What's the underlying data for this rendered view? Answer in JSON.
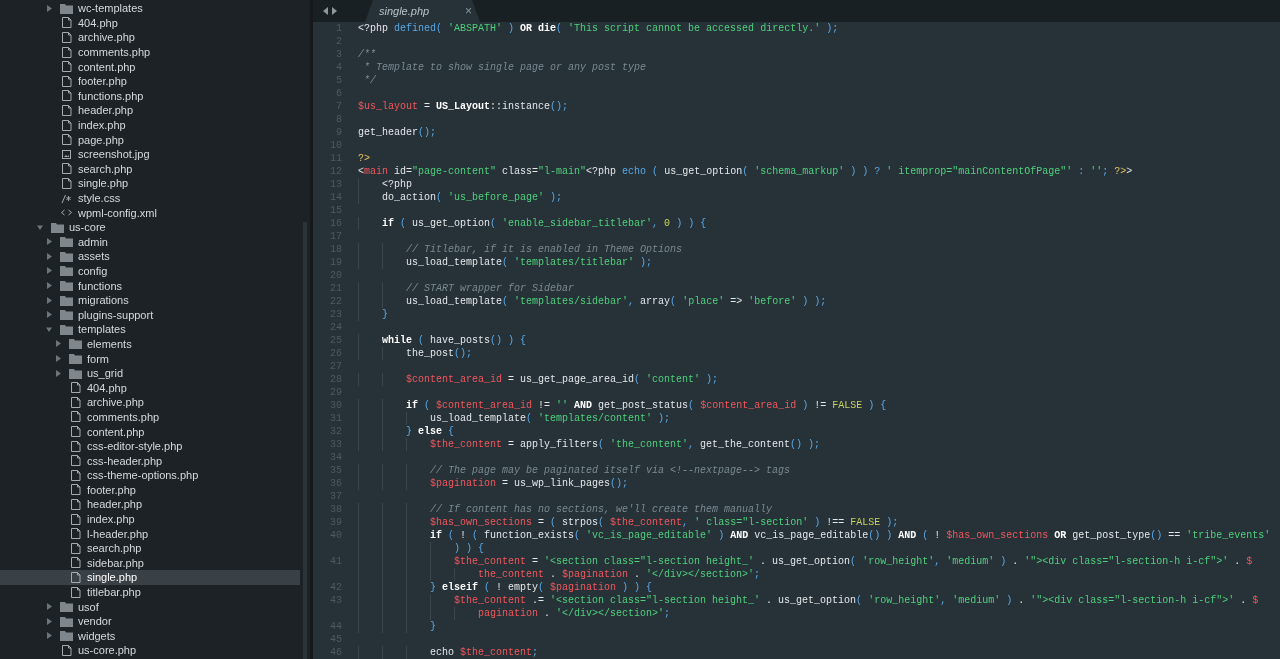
{
  "sidebar": {
    "scrolled_branch": [
      {
        "name": "wc-templates",
        "kind": "folder",
        "expanded": false,
        "selected": false
      },
      {
        "name": "404.php",
        "kind": "file",
        "selected": false
      },
      {
        "name": "archive.php",
        "kind": "file",
        "selected": false
      },
      {
        "name": "comments.php",
        "kind": "file",
        "selected": false
      },
      {
        "name": "content.php",
        "kind": "file",
        "selected": false
      },
      {
        "name": "footer.php",
        "kind": "file",
        "selected": false
      },
      {
        "name": "functions.php",
        "kind": "file",
        "selected": false
      },
      {
        "name": "header.php",
        "kind": "file",
        "selected": false
      },
      {
        "name": "index.php",
        "kind": "file",
        "selected": false
      },
      {
        "name": "page.php",
        "kind": "file",
        "selected": false
      },
      {
        "name": "screenshot.jpg",
        "kind": "image",
        "selected": false
      },
      {
        "name": "search.php",
        "kind": "file",
        "selected": false
      },
      {
        "name": "single.php",
        "kind": "file",
        "selected": false
      },
      {
        "name": "style.css",
        "kind": "css",
        "selected": false
      },
      {
        "name": "wpml-config.xml",
        "kind": "markup",
        "selected": false
      }
    ],
    "items": [
      {
        "name": "us-core",
        "kind": "folder",
        "expanded": true,
        "selected": false,
        "children": [
          {
            "name": "admin",
            "kind": "folder",
            "expanded": false,
            "selected": false
          },
          {
            "name": "assets",
            "kind": "folder",
            "expanded": false,
            "selected": false
          },
          {
            "name": "config",
            "kind": "folder",
            "expanded": false,
            "selected": false
          },
          {
            "name": "functions",
            "kind": "folder",
            "expanded": false,
            "selected": false
          },
          {
            "name": "migrations",
            "kind": "folder",
            "expanded": false,
            "selected": false
          },
          {
            "name": "plugins-support",
            "kind": "folder",
            "expanded": false,
            "selected": false
          },
          {
            "name": "templates",
            "kind": "folder",
            "expanded": true,
            "selected": false,
            "children": [
              {
                "name": "elements",
                "kind": "folder",
                "expanded": false,
                "selected": false
              },
              {
                "name": "form",
                "kind": "folder",
                "expanded": false,
                "selected": false
              },
              {
                "name": "us_grid",
                "kind": "folder",
                "expanded": false,
                "selected": false
              },
              {
                "name": "404.php",
                "kind": "file",
                "selected": false
              },
              {
                "name": "archive.php",
                "kind": "file",
                "selected": false
              },
              {
                "name": "comments.php",
                "kind": "file",
                "selected": false
              },
              {
                "name": "content.php",
                "kind": "file",
                "selected": false
              },
              {
                "name": "css-editor-style.php",
                "kind": "file",
                "selected": false
              },
              {
                "name": "css-header.php",
                "kind": "file",
                "selected": false
              },
              {
                "name": "css-theme-options.php",
                "kind": "file",
                "selected": false
              },
              {
                "name": "footer.php",
                "kind": "file",
                "selected": false
              },
              {
                "name": "header.php",
                "kind": "file",
                "selected": false
              },
              {
                "name": "index.php",
                "kind": "file",
                "selected": false
              },
              {
                "name": "l-header.php",
                "kind": "file",
                "selected": false
              },
              {
                "name": "search.php",
                "kind": "file",
                "selected": false
              },
              {
                "name": "sidebar.php",
                "kind": "file",
                "selected": false
              },
              {
                "name": "single.php",
                "kind": "file",
                "selected": true
              },
              {
                "name": "titlebar.php",
                "kind": "file",
                "selected": false
              }
            ]
          },
          {
            "name": "usof",
            "kind": "folder",
            "expanded": false,
            "selected": false
          },
          {
            "name": "vendor",
            "kind": "folder",
            "expanded": false,
            "selected": false
          },
          {
            "name": "widgets",
            "kind": "folder",
            "expanded": false,
            "selected": false
          },
          {
            "name": "us-core.php",
            "kind": "file",
            "selected": false
          }
        ]
      }
    ]
  },
  "tabs": [
    {
      "label": "single.php",
      "close": "×",
      "selected": true
    }
  ],
  "editor": {
    "lines": [
      {
        "number": "1",
        "tokens": [
          {
            "kind": "p",
            "text": "<?php "
          },
          {
            "kind": "b",
            "text": "defined( "
          },
          {
            "kind": "s",
            "text": "'ABSPATH'"
          },
          {
            "kind": "b",
            "text": " ) "
          },
          {
            "kind": "k",
            "text": "OR die"
          },
          {
            "kind": "b",
            "text": "( "
          },
          {
            "kind": "s",
            "text": "'This script cannot be accessed directly.'"
          },
          {
            "kind": "b",
            "text": " );"
          }
        ]
      },
      {
        "number": "2"
      },
      {
        "number": "3",
        "tokens": [
          {
            "kind": "c",
            "text": "/**"
          }
        ]
      },
      {
        "number": "4",
        "tokens": [
          {
            "kind": "c",
            "text": " * Template to show single page or any post type"
          }
        ]
      },
      {
        "number": "5",
        "tokens": [
          {
            "kind": "c",
            "text": " */"
          }
        ]
      },
      {
        "number": "6"
      },
      {
        "number": "7",
        "tokens": [
          {
            "kind": "v",
            "text": "$us_layout"
          },
          {
            "kind": "p",
            "text": " = "
          },
          {
            "kind": "k",
            "text": "US_Layout"
          },
          {
            "kind": "p",
            "text": "::instance"
          },
          {
            "kind": "b",
            "text": "();"
          }
        ]
      },
      {
        "number": "8"
      },
      {
        "number": "9",
        "tokens": [
          {
            "kind": "p",
            "text": "get_header"
          },
          {
            "kind": "b",
            "text": "();"
          }
        ]
      },
      {
        "number": "10"
      },
      {
        "number": "11",
        "tokens": [
          {
            "kind": "y",
            "text": "?>"
          }
        ]
      },
      {
        "number": "12",
        "tokens": [
          {
            "kind": "p",
            "text": "<"
          },
          {
            "kind": "v",
            "text": "main"
          },
          {
            "kind": "p",
            "text": " id="
          },
          {
            "kind": "s",
            "text": "\"page-content\""
          },
          {
            "kind": "p",
            "text": " class="
          },
          {
            "kind": "s",
            "text": "\"l-main\""
          },
          {
            "kind": "p",
            "text": "<?php "
          },
          {
            "kind": "b",
            "text": "echo ( "
          },
          {
            "kind": "p",
            "text": "us_get_option"
          },
          {
            "kind": "b",
            "text": "( "
          },
          {
            "kind": "s",
            "text": "'schema_markup'"
          },
          {
            "kind": "b",
            "text": " ) ) ? "
          },
          {
            "kind": "s",
            "text": "' itemprop=\"mainContentOfPage\"'"
          },
          {
            "kind": "b",
            "text": " : "
          },
          {
            "kind": "s",
            "text": "''"
          },
          {
            "kind": "b",
            "text": "; "
          },
          {
            "kind": "y",
            "text": "?>"
          },
          {
            "kind": "p",
            "text": ">"
          }
        ]
      },
      {
        "number": "13",
        "tokens": [
          {
            "kind": "p",
            "text": "    <?php"
          }
        ]
      },
      {
        "number": "14",
        "tokens": [
          {
            "kind": "p",
            "text": "    do_action"
          },
          {
            "kind": "b",
            "text": "( "
          },
          {
            "kind": "s",
            "text": "'us_before_page'"
          },
          {
            "kind": "b",
            "text": " );"
          }
        ]
      },
      {
        "number": "15"
      },
      {
        "number": "16",
        "tokens": [
          {
            "kind": "k",
            "text": "    if"
          },
          {
            "kind": "b",
            "text": " ( "
          },
          {
            "kind": "p",
            "text": "us_get_option"
          },
          {
            "kind": "b",
            "text": "( "
          },
          {
            "kind": "s",
            "text": "'enable_sidebar_titlebar'"
          },
          {
            "kind": "b",
            "text": ", "
          },
          {
            "kind": "n",
            "text": "0"
          },
          {
            "kind": "b",
            "text": " ) ) {"
          }
        ]
      },
      {
        "number": "17"
      },
      {
        "number": "18",
        "tokens": [
          {
            "kind": "c",
            "text": "        // Titlebar, if it is enabled in Theme Options"
          }
        ]
      },
      {
        "number": "19",
        "tokens": [
          {
            "kind": "p",
            "text": "        us_load_template"
          },
          {
            "kind": "b",
            "text": "( "
          },
          {
            "kind": "s",
            "text": "'templates/titlebar'"
          },
          {
            "kind": "b",
            "text": " );"
          }
        ]
      },
      {
        "number": "20"
      },
      {
        "number": "21",
        "tokens": [
          {
            "kind": "c",
            "text": "        // START wrapper for Sidebar"
          }
        ]
      },
      {
        "number": "22",
        "tokens": [
          {
            "kind": "p",
            "text": "        us_load_template"
          },
          {
            "kind": "b",
            "text": "( "
          },
          {
            "kind": "s",
            "text": "'templates/sidebar'"
          },
          {
            "kind": "b",
            "text": ", "
          },
          {
            "kind": "p",
            "text": "array"
          },
          {
            "kind": "b",
            "text": "( "
          },
          {
            "kind": "s",
            "text": "'place'"
          },
          {
            "kind": "p",
            "text": " => "
          },
          {
            "kind": "s",
            "text": "'before'"
          },
          {
            "kind": "b",
            "text": " ) );"
          }
        ]
      },
      {
        "number": "23",
        "tokens": [
          {
            "kind": "b",
            "text": "    }"
          }
        ]
      },
      {
        "number": "24"
      },
      {
        "number": "25",
        "tokens": [
          {
            "kind": "k",
            "text": "    while"
          },
          {
            "kind": "b",
            "text": " ( "
          },
          {
            "kind": "p",
            "text": "have_posts"
          },
          {
            "kind": "b",
            "text": "() ) {"
          }
        ]
      },
      {
        "number": "26",
        "tokens": [
          {
            "kind": "p",
            "text": "        the_post"
          },
          {
            "kind": "b",
            "text": "();"
          }
        ]
      },
      {
        "number": "27"
      },
      {
        "number": "28",
        "tokens": [
          {
            "kind": "v",
            "text": "        $content_area_id"
          },
          {
            "kind": "p",
            "text": " = us_get_page_area_id"
          },
          {
            "kind": "b",
            "text": "( "
          },
          {
            "kind": "s",
            "text": "'content'"
          },
          {
            "kind": "b",
            "text": " );"
          }
        ]
      },
      {
        "number": "29"
      },
      {
        "number": "30",
        "tokens": [
          {
            "kind": "k",
            "text": "        if"
          },
          {
            "kind": "b",
            "text": " ( "
          },
          {
            "kind": "v",
            "text": "$content_area_id"
          },
          {
            "kind": "p",
            "text": " != "
          },
          {
            "kind": "s",
            "text": "''"
          },
          {
            "kind": "k",
            "text": " AND"
          },
          {
            "kind": "p",
            "text": " get_post_status"
          },
          {
            "kind": "b",
            "text": "( "
          },
          {
            "kind": "v",
            "text": "$content_area_id"
          },
          {
            "kind": "b",
            "text": " ) "
          },
          {
            "kind": "p",
            "text": "!= "
          },
          {
            "kind": "n",
            "text": "FALSE"
          },
          {
            "kind": "b",
            "text": " ) {"
          }
        ]
      },
      {
        "number": "31",
        "tokens": [
          {
            "kind": "p",
            "text": "            us_load_template"
          },
          {
            "kind": "b",
            "text": "( "
          },
          {
            "kind": "s",
            "text": "'templates/content'"
          },
          {
            "kind": "b",
            "text": " );"
          }
        ]
      },
      {
        "number": "32",
        "tokens": [
          {
            "kind": "b",
            "text": "        } "
          },
          {
            "kind": "k",
            "text": "else"
          },
          {
            "kind": "b",
            "text": " {"
          }
        ]
      },
      {
        "number": "33",
        "tokens": [
          {
            "kind": "v",
            "text": "            $the_content"
          },
          {
            "kind": "p",
            "text": " = apply_filters"
          },
          {
            "kind": "b",
            "text": "( "
          },
          {
            "kind": "s",
            "text": "'the_content'"
          },
          {
            "kind": "b",
            "text": ", "
          },
          {
            "kind": "p",
            "text": "get_the_content"
          },
          {
            "kind": "b",
            "text": "() );"
          }
        ]
      },
      {
        "number": "34"
      },
      {
        "number": "35",
        "tokens": [
          {
            "kind": "c",
            "text": "            // The page may be paginated itself via <!--nextpage--> tags"
          }
        ]
      },
      {
        "number": "36",
        "tokens": [
          {
            "kind": "v",
            "text": "            $pagination"
          },
          {
            "kind": "p",
            "text": " = us_wp_link_pages"
          },
          {
            "kind": "b",
            "text": "();"
          }
        ]
      },
      {
        "number": "37"
      },
      {
        "number": "38",
        "tokens": [
          {
            "kind": "c",
            "text": "            // If content has no sections, we'll create them manually"
          }
        ]
      },
      {
        "number": "39",
        "tokens": [
          {
            "kind": "v",
            "text": "            $has_own_sections"
          },
          {
            "kind": "p",
            "text": " = "
          },
          {
            "kind": "b",
            "text": "( "
          },
          {
            "kind": "p",
            "text": "strpos"
          },
          {
            "kind": "b",
            "text": "( "
          },
          {
            "kind": "v",
            "text": "$the_content"
          },
          {
            "kind": "b",
            "text": ", "
          },
          {
            "kind": "s",
            "text": "' class=\"l-section'"
          },
          {
            "kind": "b",
            "text": " ) "
          },
          {
            "kind": "p",
            "text": "!== "
          },
          {
            "kind": "n",
            "text": "FALSE"
          },
          {
            "kind": "b",
            "text": " );"
          }
        ]
      },
      {
        "number": "40",
        "tokens": [
          {
            "kind": "k",
            "text": "            if"
          },
          {
            "kind": "b",
            "text": " ( "
          },
          {
            "kind": "p",
            "text": "! "
          },
          {
            "kind": "b",
            "text": "( "
          },
          {
            "kind": "p",
            "text": "function_exists"
          },
          {
            "kind": "b",
            "text": "( "
          },
          {
            "kind": "s",
            "text": "'vc_is_page_editable'"
          },
          {
            "kind": "b",
            "text": " ) "
          },
          {
            "kind": "k",
            "text": "AND"
          },
          {
            "kind": "p",
            "text": " vc_is_page_editable"
          },
          {
            "kind": "b",
            "text": "() ) "
          },
          {
            "kind": "k",
            "text": "AND"
          },
          {
            "kind": "b",
            "text": " ( "
          },
          {
            "kind": "p",
            "text": "! "
          },
          {
            "kind": "v",
            "text": "$has_own_sections"
          },
          {
            "kind": "k",
            "text": " OR"
          },
          {
            "kind": "p",
            "text": " get_post_type"
          },
          {
            "kind": "b",
            "text": "() "
          },
          {
            "kind": "p",
            "text": "== "
          },
          {
            "kind": "s",
            "text": "'tribe_events'"
          }
        ]
      },
      {
        "tokens": [
          {
            "kind": "b",
            "text": "                ) ) {"
          }
        ]
      },
      {
        "number": "41",
        "tokens": [
          {
            "kind": "v",
            "text": "                $the_content"
          },
          {
            "kind": "p",
            "text": " = "
          },
          {
            "kind": "s",
            "text": "'<section class=\"l-section height_'"
          },
          {
            "kind": "p",
            "text": " . us_get_option"
          },
          {
            "kind": "b",
            "text": "( "
          },
          {
            "kind": "s",
            "text": "'row_height'"
          },
          {
            "kind": "b",
            "text": ", "
          },
          {
            "kind": "s",
            "text": "'medium'"
          },
          {
            "kind": "b",
            "text": " ) "
          },
          {
            "kind": "p",
            "text": ". "
          },
          {
            "kind": "s",
            "text": "'\"><div class=\"l-section-h i-cf\">'"
          },
          {
            "kind": "p",
            "text": " . "
          },
          {
            "kind": "v",
            "text": "$"
          }
        ]
      },
      {
        "tokens": [
          {
            "kind": "v",
            "text": "                    the_content"
          },
          {
            "kind": "p",
            "text": " . "
          },
          {
            "kind": "v",
            "text": "$pagination"
          },
          {
            "kind": "p",
            "text": " . "
          },
          {
            "kind": "s",
            "text": "'</div></section>'"
          },
          {
            "kind": "b",
            "text": ";"
          }
        ]
      },
      {
        "number": "42",
        "tokens": [
          {
            "kind": "b",
            "text": "            } "
          },
          {
            "kind": "k",
            "text": "elseif"
          },
          {
            "kind": "b",
            "text": " ( "
          },
          {
            "kind": "p",
            "text": "! empty"
          },
          {
            "kind": "b",
            "text": "( "
          },
          {
            "kind": "v",
            "text": "$pagination"
          },
          {
            "kind": "b",
            "text": " ) ) {"
          }
        ]
      },
      {
        "number": "43",
        "tokens": [
          {
            "kind": "v",
            "text": "                $the_content"
          },
          {
            "kind": "p",
            "text": " .= "
          },
          {
            "kind": "s",
            "text": "'<section class=\"l-section height_'"
          },
          {
            "kind": "p",
            "text": " . us_get_option"
          },
          {
            "kind": "b",
            "text": "( "
          },
          {
            "kind": "s",
            "text": "'row_height'"
          },
          {
            "kind": "b",
            "text": ", "
          },
          {
            "kind": "s",
            "text": "'medium'"
          },
          {
            "kind": "b",
            "text": " ) "
          },
          {
            "kind": "p",
            "text": ". "
          },
          {
            "kind": "s",
            "text": "'\"><div class=\"l-section-h i-cf\">'"
          },
          {
            "kind": "p",
            "text": " . "
          },
          {
            "kind": "v",
            "text": "$"
          }
        ]
      },
      {
        "tokens": [
          {
            "kind": "v",
            "text": "                    pagination"
          },
          {
            "kind": "p",
            "text": " . "
          },
          {
            "kind": "s",
            "text": "'</div></section>'"
          },
          {
            "kind": "b",
            "text": ";"
          }
        ]
      },
      {
        "number": "44",
        "tokens": [
          {
            "kind": "b",
            "text": "            }"
          }
        ]
      },
      {
        "number": "45"
      },
      {
        "number": "46",
        "tokens": [
          {
            "kind": "p",
            "text": "            echo "
          },
          {
            "kind": "v",
            "text": "$the_content"
          },
          {
            "kind": "b",
            "text": ";"
          }
        ]
      }
    ]
  }
}
